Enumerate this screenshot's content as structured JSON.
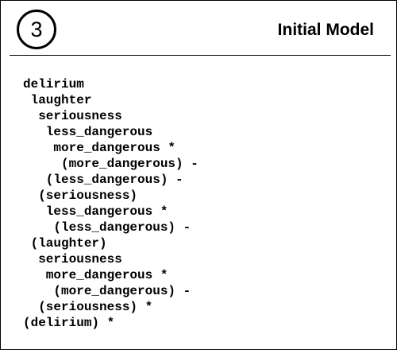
{
  "header": {
    "step_number": "3",
    "title": "Initial Model"
  },
  "model_tree": [
    "delirium",
    " laughter",
    "  seriousness",
    "   less_dangerous",
    "    more_dangerous *",
    "     (more_dangerous) -",
    "   (less_dangerous) -",
    "  (seriousness)",
    "   less_dangerous *",
    "    (less_dangerous) -",
    " (laughter)",
    "  seriousness",
    "   more_dangerous *",
    "    (more_dangerous) -",
    "  (seriousness) *",
    "(delirium) *"
  ]
}
